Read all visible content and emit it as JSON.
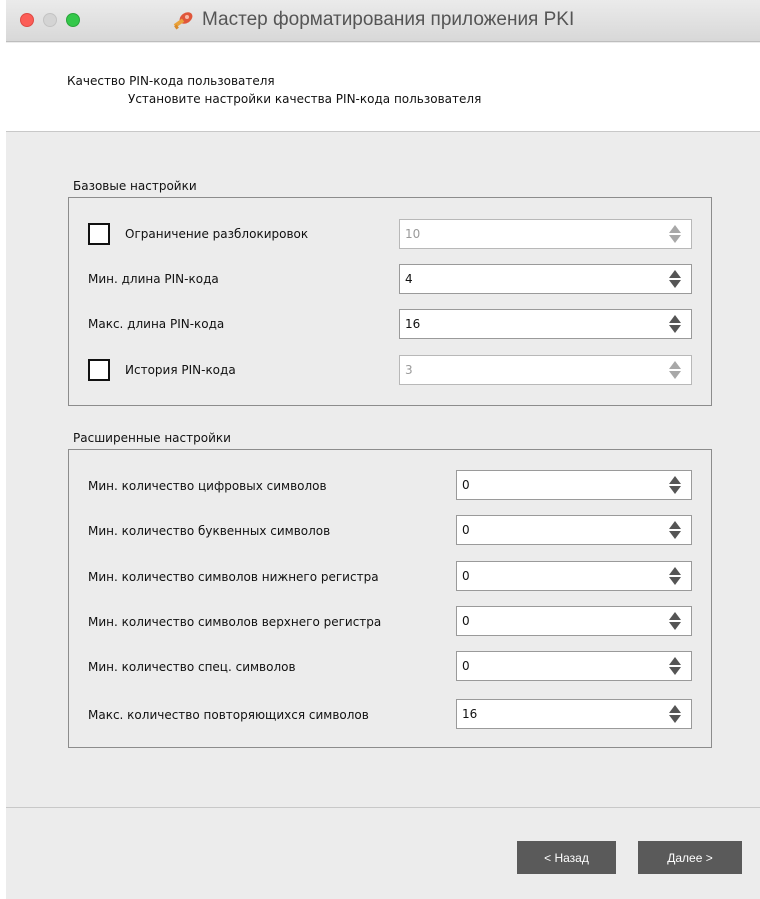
{
  "window": {
    "title": "Мастер форматирования приложения PKI",
    "icon": "pki-app-icon"
  },
  "header": {
    "title": "Качество PIN-кода пользователя",
    "subtitle": "Установите настройки качества PIN-кода пользователя"
  },
  "basic": {
    "group_label": "Базовые настройки",
    "unlock_limit": {
      "label": "Ограничение разблокировок",
      "checked": false,
      "value": "10",
      "enabled": false
    },
    "min_length": {
      "label": "Мин. длина PIN-кода",
      "value": "4"
    },
    "max_length": {
      "label": "Макс. длина PIN-кода",
      "value": "16"
    },
    "history": {
      "label": "История PIN-кода",
      "checked": false,
      "value": "3",
      "enabled": false
    }
  },
  "advanced": {
    "group_label": "Расширенные настройки",
    "rows": [
      {
        "label": "Мин. количество цифровых символов",
        "value": "0"
      },
      {
        "label": "Мин. количество буквенных символов",
        "value": "0"
      },
      {
        "label": "Мин. количество символов нижнего регистра",
        "value": "0"
      },
      {
        "label": "Мин. количество символов верхнего регистра",
        "value": "0"
      },
      {
        "label": "Мин. количество спец. символов",
        "value": "0"
      },
      {
        "label": "Макс. количество повторяющихся символов",
        "value": "16"
      }
    ]
  },
  "footer": {
    "back_label": "< Назад",
    "next_label": "Далее >"
  },
  "colors": {
    "close": "#fc5d57",
    "minimize": "#d4d4d4",
    "maximize": "#34c84a",
    "button_bg": "#5a5a5a",
    "panel_bg": "#ececec"
  }
}
